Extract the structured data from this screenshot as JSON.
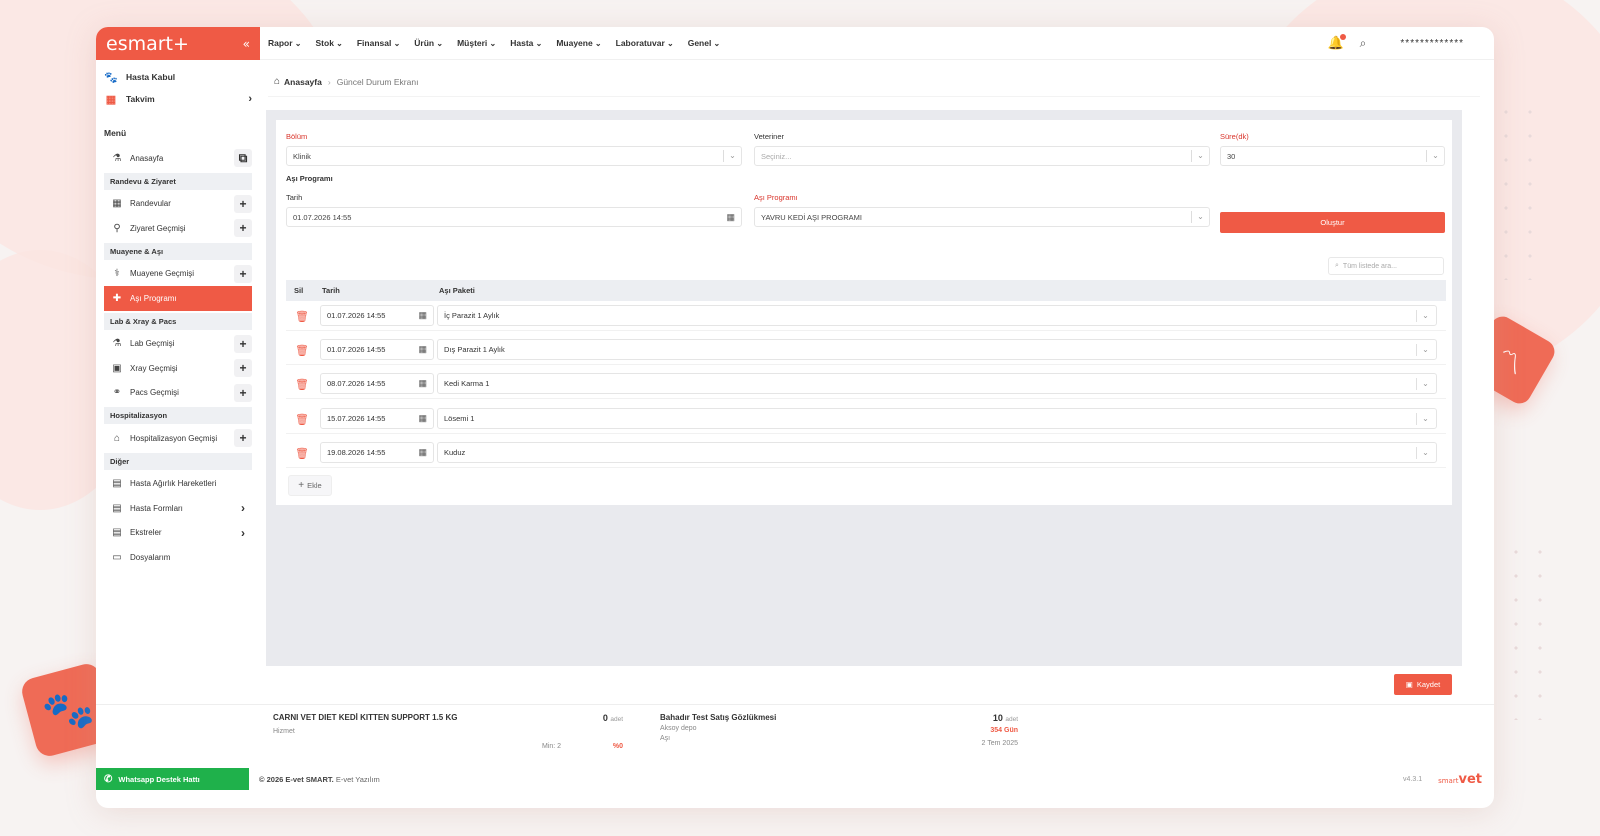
{
  "app": {
    "logo": "esmart+",
    "collapse_icon": "«",
    "accent": "#ef5a45"
  },
  "quick_links": [
    {
      "label": "Hasta Kabul",
      "icon": "paw-icon"
    },
    {
      "label": "Takvim",
      "icon": "calendar-icon"
    }
  ],
  "sidebar": {
    "menu_title": "Menü",
    "home": "Anasayfa",
    "group_randevu": "Randevu & Ziyaret",
    "randevular": "Randevular",
    "ziyaret": "Ziyaret Geçmişi",
    "group_muayene": "Muayene & Aşı",
    "muayene": "Muayene Geçmişi",
    "asi": "Aşı Programı",
    "group_lab": "Lab & Xray & Pacs",
    "lab": "Lab Geçmişi",
    "xray": "Xray Geçmişi",
    "pacs": "Pacs Geçmişi",
    "group_hosp": "Hospitalizasyon",
    "hosp": "Hospitalizasyon Geçmişi",
    "group_diger": "Diğer",
    "agirlik": "Hasta Ağırlık Hareketleri",
    "formlar": "Hasta Formları",
    "ekstreler": "Ekstreler",
    "dosyalar": "Dosyalarım"
  },
  "topnav": [
    "Rapor",
    "Stok",
    "Finansal",
    "Ürün",
    "Müşteri",
    "Hasta",
    "Muayene",
    "Laboratuvar",
    "Genel"
  ],
  "user": {
    "masked_name": "*************"
  },
  "breadcrumb": {
    "home": "Anasayfa",
    "current": "Güncel Durum Ekranı"
  },
  "form": {
    "bolum_label": "Bölüm",
    "bolum_value": "Klinik",
    "veteriner_label": "Veteriner",
    "veteriner_placeholder": "Seçiniz...",
    "sure_label": "Süre(dk)",
    "sure_value": "30",
    "section_title": "Aşı Programı",
    "tarih_label": "Tarih",
    "tarih_value": "01.07.2026 14:55",
    "program_label": "Aşı Programı",
    "program_value": "YAVRU KEDİ AŞI PROGRAMI",
    "create_button": "Oluştur"
  },
  "table": {
    "search_placeholder": "Tüm listede ara...",
    "headers": {
      "delete": "Sil",
      "date": "Tarih",
      "package": "Aşı Paketi"
    },
    "rows": [
      {
        "date": "01.07.2026 14:55",
        "package": "İç Parazit 1 Aylık"
      },
      {
        "date": "01.07.2026 14:55",
        "package": "Dış Parazit 1 Aylık"
      },
      {
        "date": "08.07.2026 14:55",
        "package": "Kedi Karma 1"
      },
      {
        "date": "15.07.2026 14:55",
        "package": "Lösemi 1"
      },
      {
        "date": "19.08.2026 14:55",
        "package": "Kuduz"
      }
    ],
    "add_button": "Ekle"
  },
  "save_button": "Kaydet",
  "stock_items": [
    {
      "name": "CARNI VET DIET KEDİ KITTEN SUPPORT 1.5 KG",
      "qty": "0",
      "unit": "adet",
      "type": "Hizmet",
      "min": "Min: 2",
      "percent": "%0"
    },
    {
      "name": "Bahadır Test Satış Gözlükmesi",
      "qty": "10",
      "unit": "adet",
      "depot": "Aksoy depo",
      "days": "354 Gün",
      "type": "Aşı",
      "date": "2 Tem 2025"
    }
  ],
  "footer": {
    "whatsapp": "Whatsapp Destek Hattı",
    "copyright": "© 2026 E-vet SMART.",
    "company": "E-vet Yazılım",
    "version": "v4.3.1",
    "brand_small": "smart",
    "brand": "vet"
  }
}
